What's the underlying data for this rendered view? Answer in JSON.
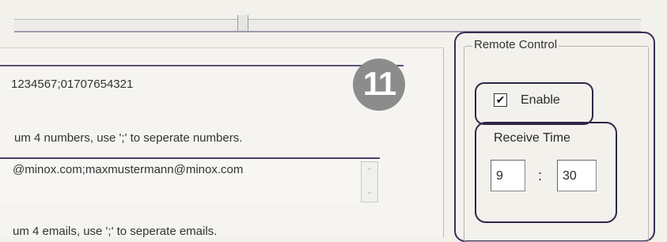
{
  "recipients": {
    "phone_value": "1234567;01707654321",
    "phone_hint": "um 4 numbers, use ';' to  seperate  numbers.",
    "email_value": "@minox.com;maxmustermann@minox.com",
    "email_hint": "um 4 emails, use ';' to seperate emails."
  },
  "badge": {
    "number": "11"
  },
  "remote_control": {
    "legend": "Remote Control",
    "enable_label": "Enable",
    "enable_checked": true,
    "receive_time_label": "Receive Time",
    "hour": "9",
    "separator": ":",
    "minute": "30"
  },
  "spinner": {
    "up_glyph": "⌃",
    "down_glyph": "⌄"
  },
  "check_glyph": "✔"
}
